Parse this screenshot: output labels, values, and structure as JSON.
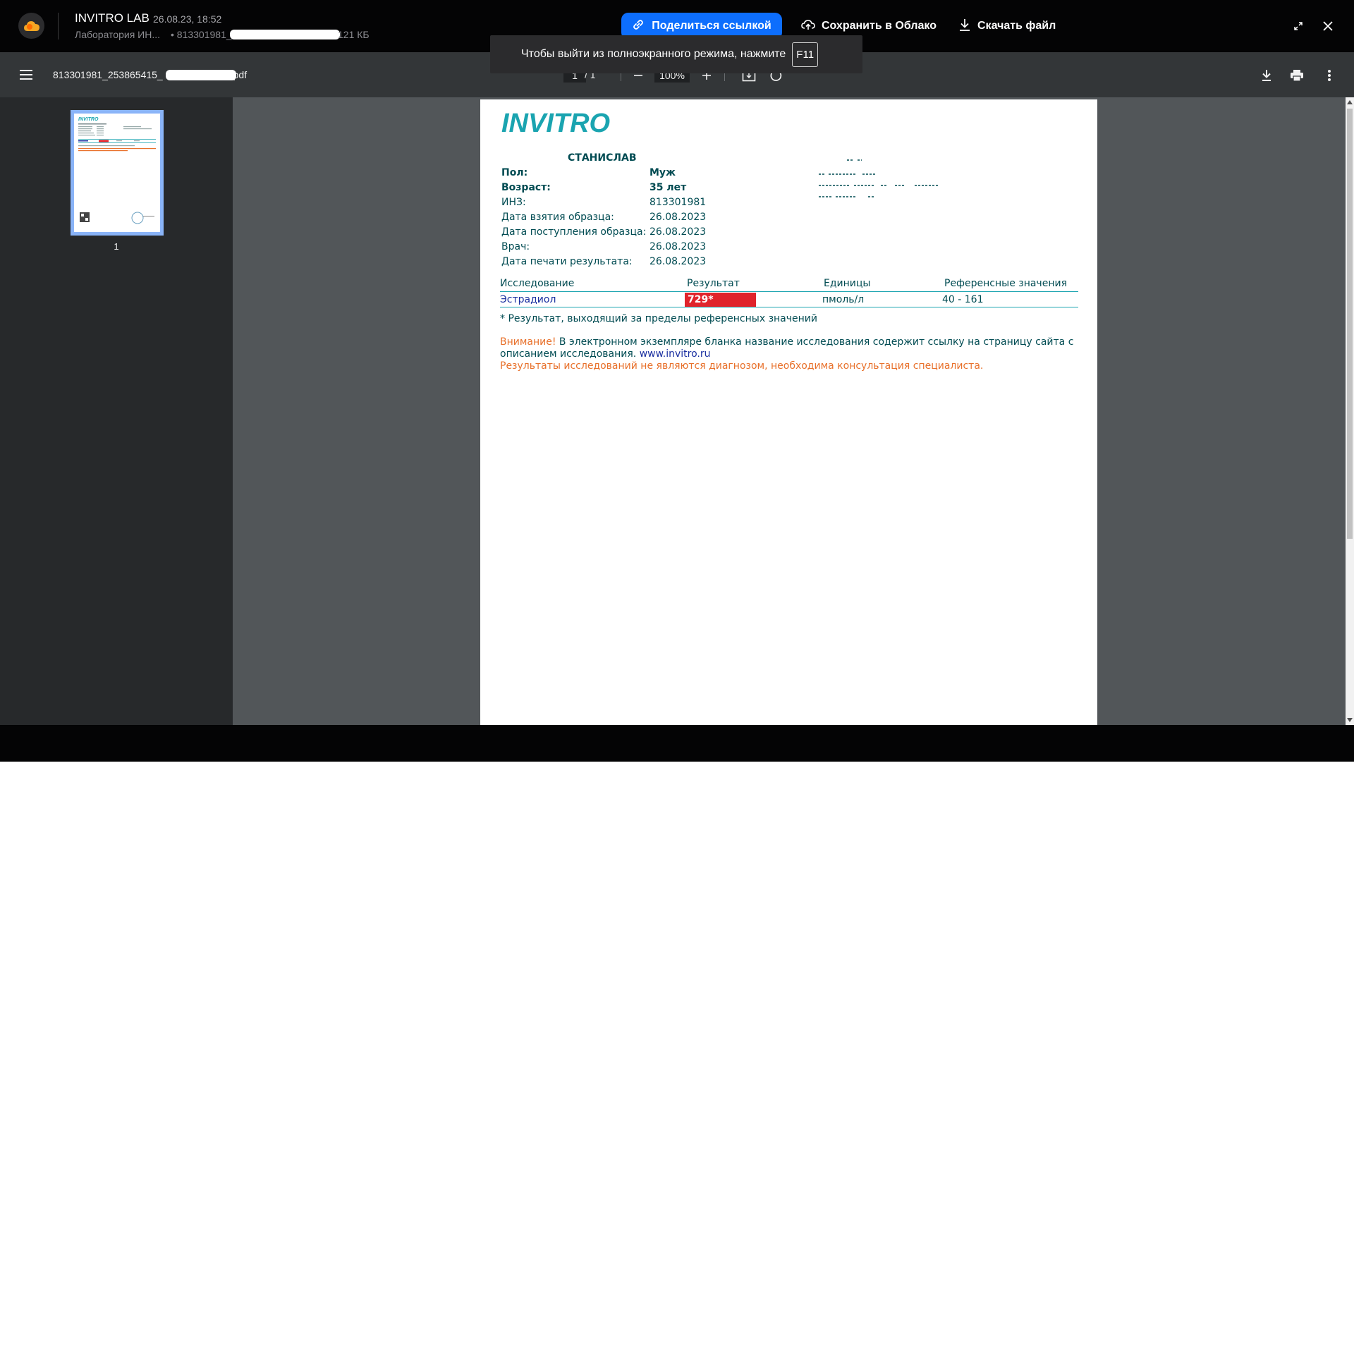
{
  "mail": {
    "sender": "INVITRO LAB",
    "date": "26.08.23, 18:52",
    "folder": "Лаборатория ИН...",
    "file_prefix": "• 813301981_",
    "file_size": "121 КБ",
    "share_label": "Поделиться ссылкой",
    "save_cloud_label": "Сохранить в Облако",
    "download_label": "Скачать файл"
  },
  "fullscreen_tip": {
    "text": "Чтобы выйти из полноэкранного режима, нажмите",
    "key": "F11"
  },
  "viewer": {
    "filename_prefix": "813301981_253865415_",
    "filename_suffix": ".pdf",
    "page_current": "1",
    "page_total": "/ 1",
    "zoom": "100%",
    "thumbnail_label": "1"
  },
  "report": {
    "brand": "INVITRO",
    "patient_first_name": "СТАНИСЛАВ",
    "labels": {
      "sex": "Пол:",
      "age": "Возраст:",
      "inz": "ИНЗ:",
      "sample_taken": "Дата взятия образца:",
      "sample_received": "Дата поступления образца:",
      "doctor": "Врач:",
      "print_date": "Дата печати результата:"
    },
    "values": {
      "sex": "Муж",
      "age": "35 лет",
      "inz": "813301981",
      "sample_taken": "26.08.2023",
      "sample_received": "26.08.2023",
      "doctor": "26.08.2023",
      "print_date": "26.08.2023"
    },
    "table": {
      "headers": [
        "Исследование",
        "Результат",
        "Единицы",
        "Референсные значения"
      ],
      "rows": [
        {
          "test": "Эстрадиол",
          "result": "729*",
          "units": "пмоль/л",
          "reference": "40 - 161"
        }
      ]
    },
    "footnote": "* Результат, выходящий за пределы референсных значений",
    "notice_label": "Внимание!",
    "notice_text": " В электронном экземпляре бланка название исследования содержит ссылку на страницу сайта с описанием исследования. ",
    "notice_link": "www.invitro.ru",
    "disclaimer": "Результаты исследований не являются диагнозом, необходима консультация специалиста."
  },
  "colors": {
    "brand_teal": "#1aa4b0",
    "result_out_of_range": "#e0232b",
    "share_button": "#0d6efd"
  }
}
